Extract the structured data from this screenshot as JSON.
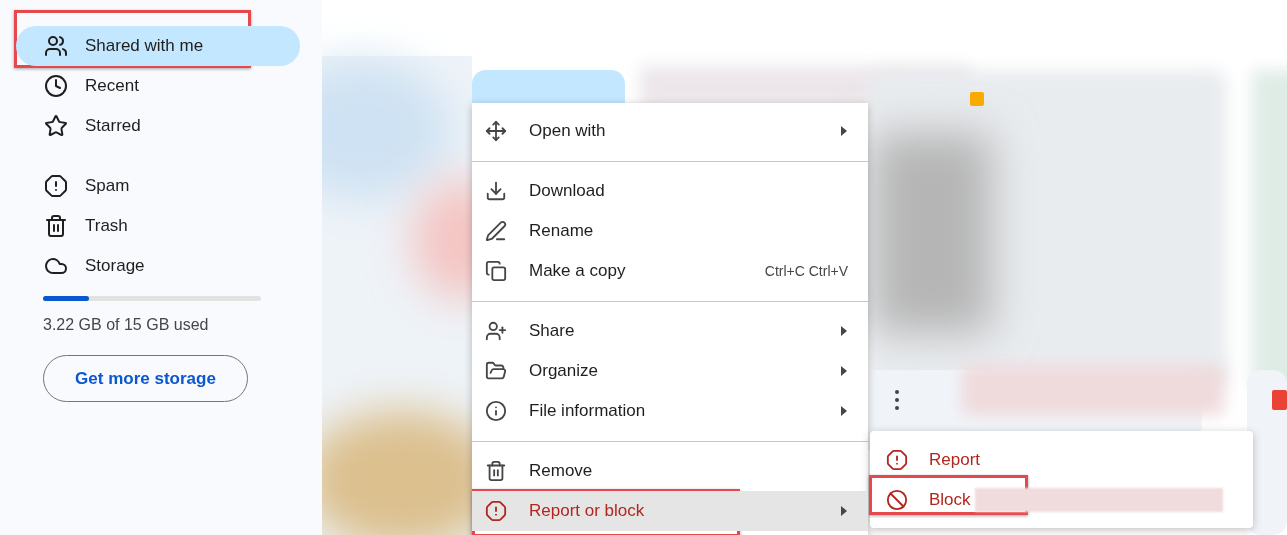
{
  "sidebar": {
    "items": [
      {
        "label": "Shared with me",
        "selected": true,
        "highlighted": true
      },
      {
        "label": "Recent",
        "selected": false,
        "highlighted": false
      },
      {
        "label": "Starred",
        "selected": false,
        "highlighted": false
      },
      {
        "label": "Spam",
        "selected": false,
        "highlighted": false
      },
      {
        "label": "Trash",
        "selected": false,
        "highlighted": false
      },
      {
        "label": "Storage",
        "selected": false,
        "highlighted": false
      }
    ],
    "storage": {
      "level": 0.21,
      "text": "3.22 GB of 15 GB used",
      "button": "Get more storage"
    }
  },
  "context_menu": {
    "groups": [
      [
        {
          "label": "Open with",
          "submenu": true,
          "kind": "normal",
          "hovered": false,
          "highlighted": false
        }
      ],
      [
        {
          "label": "Download",
          "submenu": false,
          "kind": "normal",
          "hovered": false,
          "highlighted": false
        },
        {
          "label": "Rename",
          "submenu": false,
          "kind": "normal",
          "hovered": false,
          "highlighted": false
        },
        {
          "label": "Make a copy",
          "submenu": false,
          "shortcut": "Ctrl+C Ctrl+V",
          "kind": "normal",
          "hovered": false,
          "highlighted": false
        }
      ],
      [
        {
          "label": "Share",
          "submenu": true,
          "kind": "normal",
          "hovered": false,
          "highlighted": false
        },
        {
          "label": "Organize",
          "submenu": true,
          "kind": "normal",
          "hovered": false,
          "highlighted": false
        },
        {
          "label": "File information",
          "submenu": true,
          "kind": "normal",
          "hovered": false,
          "highlighted": false
        }
      ],
      [
        {
          "label": "Remove",
          "submenu": false,
          "kind": "normal",
          "hovered": false,
          "highlighted": false
        },
        {
          "label": "Report or block",
          "submenu": true,
          "kind": "danger",
          "hovered": true,
          "highlighted": true
        }
      ]
    ]
  },
  "submenu": {
    "items": [
      {
        "label": "Report",
        "kind": "danger",
        "highlighted": false,
        "redacted": false
      },
      {
        "label": "Block",
        "kind": "danger",
        "highlighted": true,
        "redacted": true
      }
    ]
  }
}
